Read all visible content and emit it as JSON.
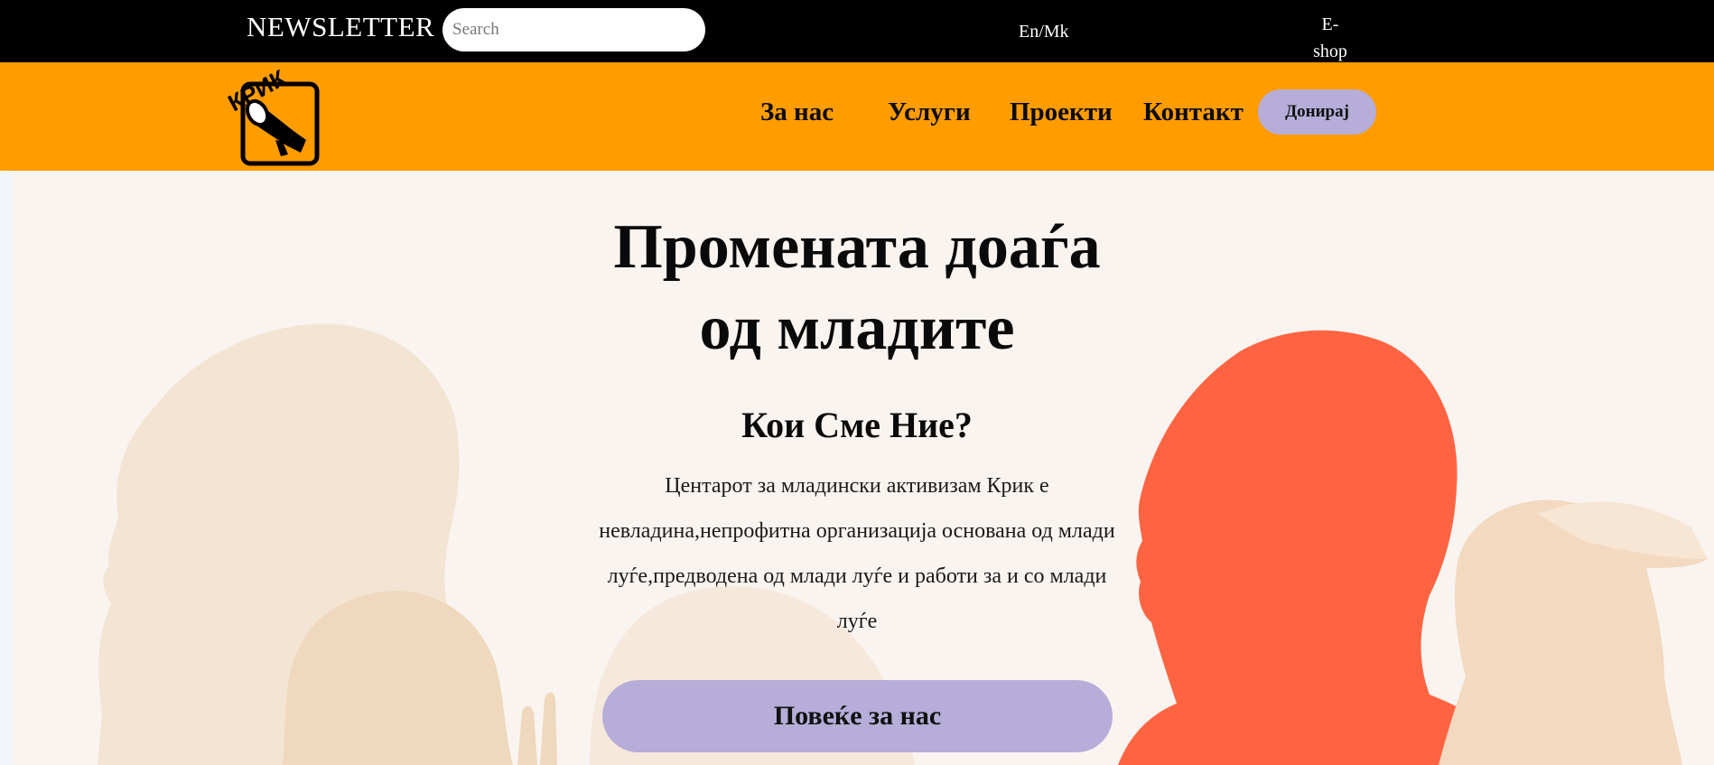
{
  "topbar": {
    "newsletter_label": "NEWSLETTER",
    "search_placeholder": "Search",
    "search_value": "",
    "language_toggle": "En/Mk",
    "eshop_line1": "E-",
    "eshop_line2": "shop"
  },
  "nav": {
    "logo_icon": "megaphone-logo-icon",
    "logo_text": "КРИК",
    "items": [
      {
        "label": "За нас"
      },
      {
        "label": "Услуги"
      },
      {
        "label": "Проекти"
      },
      {
        "label": "Контакт"
      }
    ],
    "donate_label": "Донирај"
  },
  "hero": {
    "title_line1": "Промената доаѓа",
    "title_line2": "од младите",
    "who_title": "Кои Сме Ние?",
    "who_text": "Центарот за младински активизам Крик е невладина,непрофитна организација основана од млади луѓе,предводена од млади луѓе и работи за и со млади луѓе",
    "more_button": "Повеќе за нас"
  },
  "colors": {
    "topbar": "#000000",
    "navbar": "#ff9c00",
    "accent_button": "#b6add8",
    "hero_background": "#f9f4f0",
    "silhouette_light": "#f3dcc0",
    "silhouette_red": "#ff6442"
  }
}
